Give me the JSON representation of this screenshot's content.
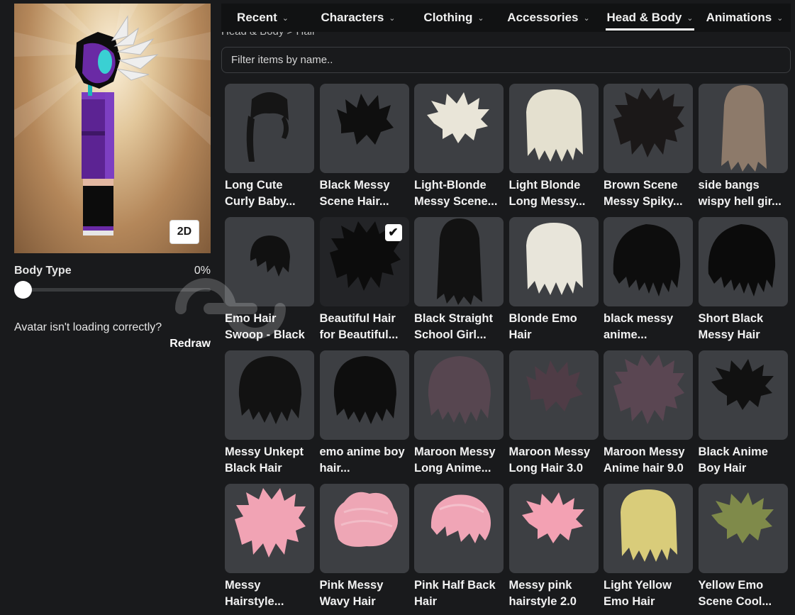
{
  "avatar": {
    "view_toggle_label": "2D"
  },
  "body_type": {
    "label": "Body Type",
    "value": "0%",
    "level": 0
  },
  "loading": {
    "text": "Avatar isn't loading correctly?",
    "redraw_label": "Redraw"
  },
  "tabs": [
    {
      "label": "Recent",
      "active": false
    },
    {
      "label": "Characters",
      "active": false
    },
    {
      "label": "Clothing",
      "active": false
    },
    {
      "label": "Accessories",
      "active": false
    },
    {
      "label": "Head & Body",
      "active": true
    },
    {
      "label": "Animations",
      "active": false
    }
  ],
  "breadcrumb": "Head & Body > Hair",
  "filter": {
    "placeholder": "Filter items by name.."
  },
  "items": [
    {
      "name": "Long Cute Curly Baby...",
      "color": "#151515",
      "style": "ponytail",
      "selected": false
    },
    {
      "name": "Black Messy Scene Hair...",
      "color": "#0f0f0f",
      "style": "messy",
      "selected": false
    },
    {
      "name": "Light-Blonde Messy Scene...",
      "color": "#e9e5d8",
      "style": "spiky-small",
      "selected": false
    },
    {
      "name": "Light Blonde Long Messy...",
      "color": "#e4e0cf",
      "style": "long-messy",
      "selected": false
    },
    {
      "name": "Brown Scene Messy Spiky...",
      "color": "#1b1818",
      "style": "spiky",
      "selected": false
    },
    {
      "name": "side bangs wispy hell gir...",
      "color": "#8d7a6a",
      "style": "long-straight",
      "selected": false
    },
    {
      "name": "Emo Hair Swoop - Black",
      "color": "#111111",
      "style": "swoop",
      "selected": false
    },
    {
      "name": "Beautiful Hair for Beautiful...",
      "color": "#0c0c0c",
      "style": "spiky",
      "selected": true
    },
    {
      "name": "Black Straight School Girl...",
      "color": "#121212",
      "style": "long-straight",
      "selected": false
    },
    {
      "name": "Blonde Emo Hair",
      "color": "#e8e5da",
      "style": "long-messy",
      "selected": false
    },
    {
      "name": "black messy anime...",
      "color": "#0d0d0d",
      "style": "emo",
      "selected": false
    },
    {
      "name": "Short Black Messy Hair",
      "color": "#0b0b0b",
      "style": "emo",
      "selected": false
    },
    {
      "name": "Messy Unkept Black Hair",
      "color": "#121212",
      "style": "bob",
      "selected": false
    },
    {
      "name": "emo anime boy hair...",
      "color": "#0e0e0e",
      "style": "bob",
      "selected": false
    },
    {
      "name": "Maroon Messy Long Anime...",
      "color": "#574650",
      "style": "bob",
      "selected": false
    },
    {
      "name": "Maroon Messy Long Hair 3.0",
      "color": "#4f3c46",
      "style": "messy",
      "selected": false
    },
    {
      "name": "Maroon Messy Anime hair 9.0",
      "color": "#5a4652",
      "style": "spiky",
      "selected": false
    },
    {
      "name": "Black Anime Boy Hair",
      "color": "#111111",
      "style": "spiky-small",
      "selected": false
    },
    {
      "name": "Messy Hairstyle...",
      "color": "#f1a3b4",
      "style": "spiky",
      "selected": false
    },
    {
      "name": "Pink Messy Wavy Hair",
      "color": "#eea6b5",
      "style": "wavy-bun",
      "selected": false
    },
    {
      "name": "Pink Half Back Hair",
      "color": "#f0a5b6",
      "style": "slicked",
      "selected": false
    },
    {
      "name": "Messy pink hairstyle 2.0",
      "color": "#f3a1b3",
      "style": "spiky-small",
      "selected": false
    },
    {
      "name": "Light Yellow Emo Hair",
      "color": "#d9cc7a",
      "style": "long-messy",
      "selected": false
    },
    {
      "name": "Yellow Emo Scene Cool...",
      "color": "#7f8a4a",
      "style": "spiky-small",
      "selected": false
    }
  ]
}
